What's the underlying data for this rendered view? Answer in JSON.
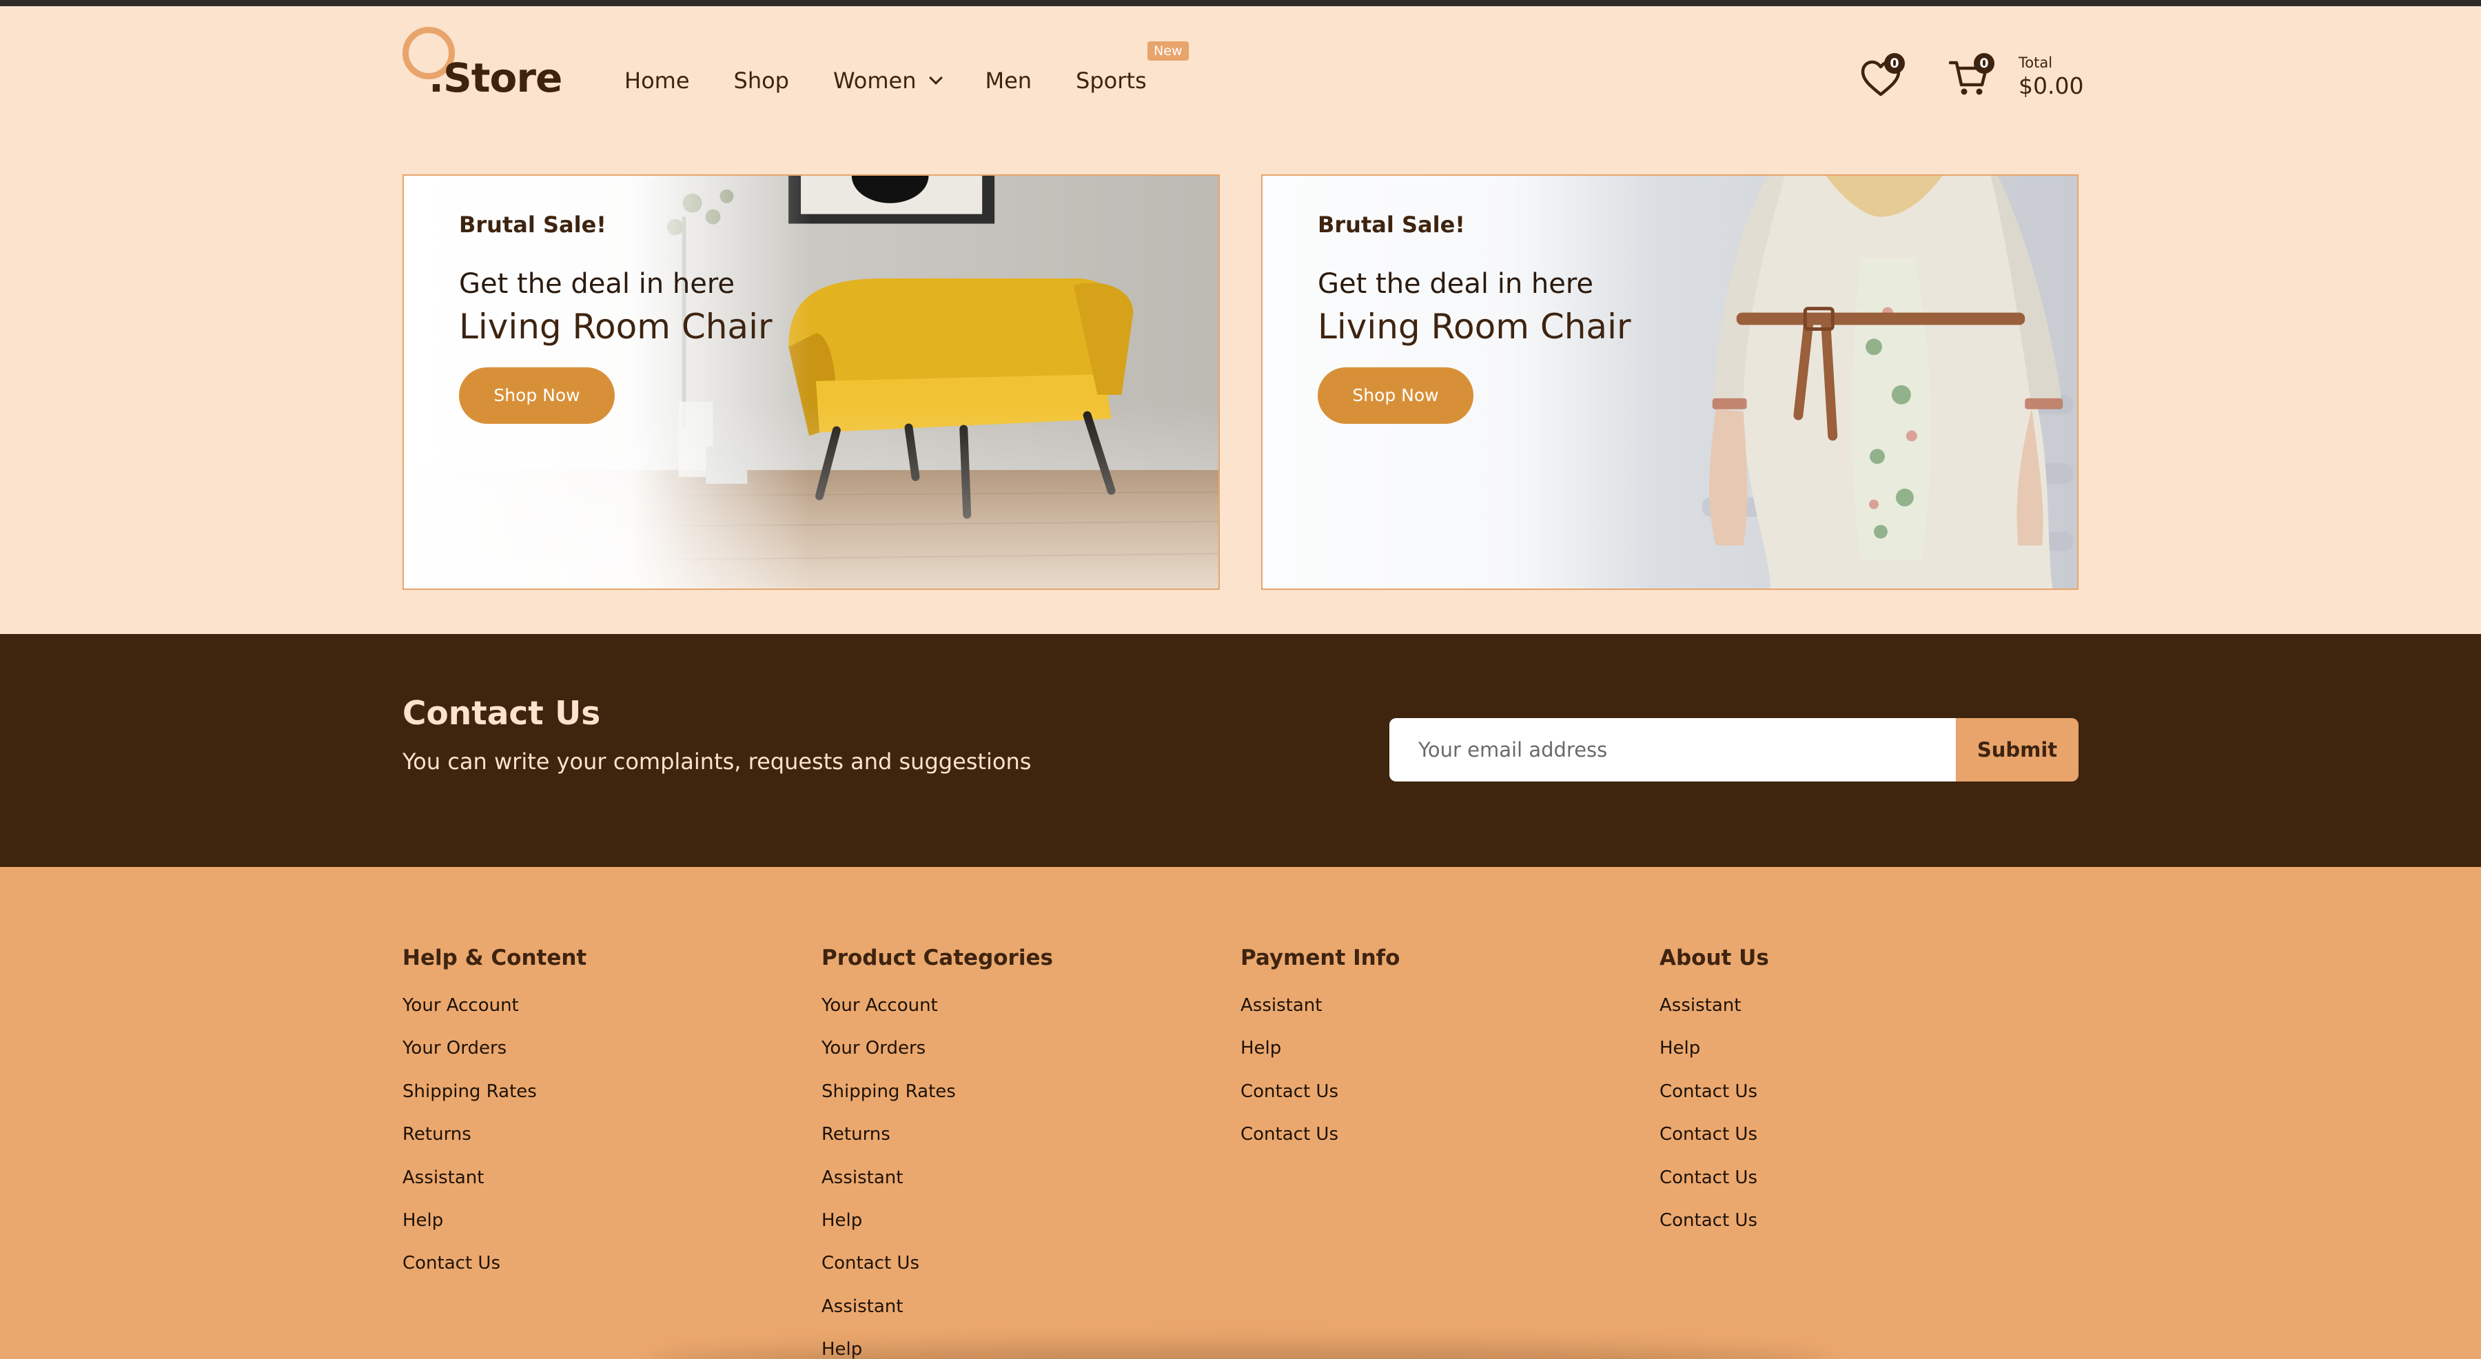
{
  "header": {
    "logo_text": ".Store",
    "nav": [
      {
        "label": "Home"
      },
      {
        "label": "Shop"
      },
      {
        "label": "Women"
      },
      {
        "label": "Men"
      },
      {
        "label": "Sports",
        "badge": "New"
      }
    ],
    "wishlist_count": "0",
    "cart_count": "0",
    "total_label": "Total",
    "total_value": "$0.00"
  },
  "banners": [
    {
      "kicker": "Brutal Sale!",
      "subtitle": "Get the deal in here",
      "title": "Living Room Chair",
      "button": "Shop Now"
    },
    {
      "kicker": "Brutal Sale!",
      "subtitle": "Get the deal in here",
      "title": "Living Room Chair",
      "button": "Shop Now"
    }
  ],
  "contact": {
    "title": "Contact Us",
    "subtitle": "You can write your complaints, requests and suggestions",
    "email_placeholder": "Your email address",
    "submit_label": "Submit"
  },
  "footer": {
    "columns": [
      {
        "heading": "Help & Content",
        "links": [
          "Your Account",
          "Your Orders",
          "Shipping Rates",
          "Returns",
          "Assistant",
          "Help",
          "Contact Us"
        ]
      },
      {
        "heading": "Product Categories",
        "links": [
          "Your Account",
          "Your Orders",
          "Shipping Rates",
          "Returns",
          "Assistant",
          "Help",
          "Contact Us",
          "Assistant",
          "Help"
        ]
      },
      {
        "heading": "Payment Info",
        "links": [
          "Assistant",
          "Help",
          "Contact Us",
          "Contact Us"
        ]
      },
      {
        "heading": "About Us",
        "links": [
          "Assistant",
          "Help",
          "Contact Us",
          "Contact Us",
          "Contact Us",
          "Contact Us"
        ]
      }
    ]
  },
  "colors": {
    "page_bg": "#fbe3cd",
    "brand_dark": "#3f250d",
    "accent": "#e8a46b",
    "button": "#d89038"
  }
}
